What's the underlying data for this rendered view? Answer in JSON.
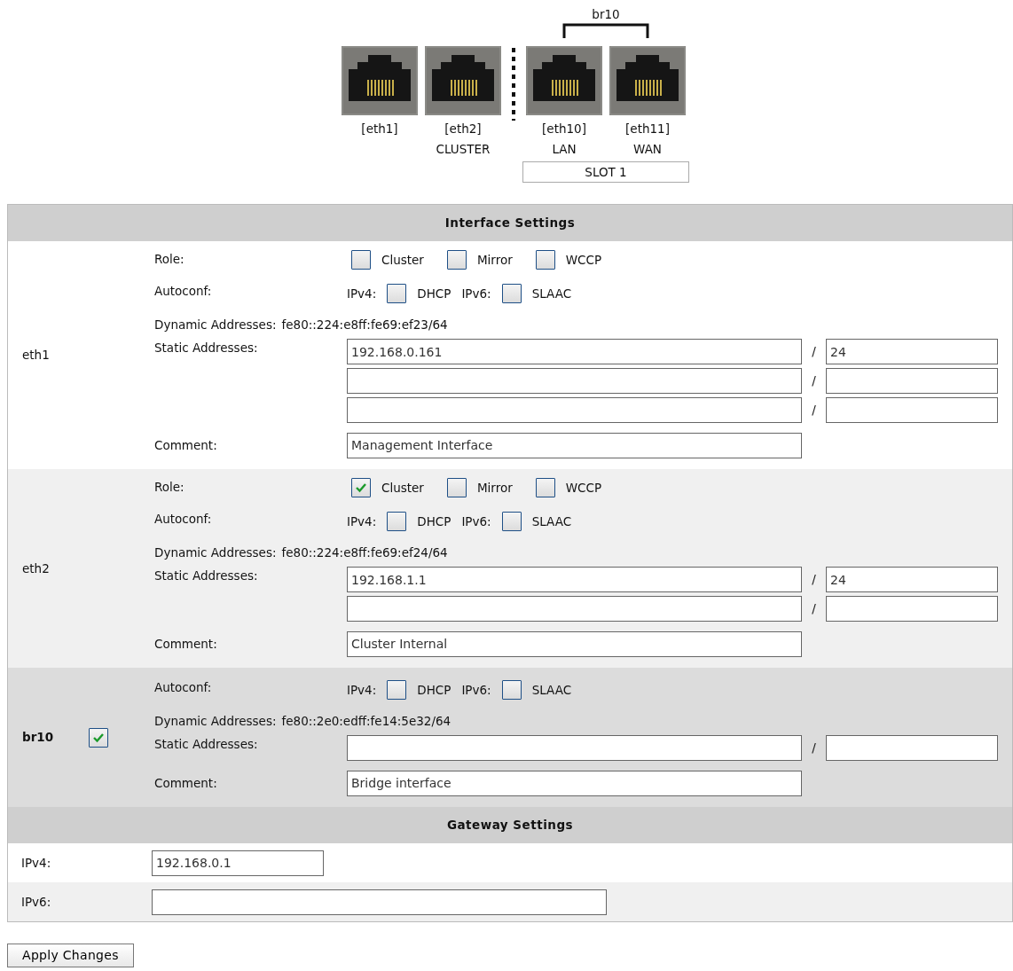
{
  "onboard_ports": [
    {
      "label": "[eth1]"
    },
    {
      "label": "[eth2]",
      "sublabel": "CLUSTER"
    }
  ],
  "slot": {
    "label": "SLOT 1",
    "bridge_label": "br10",
    "ports": [
      {
        "label": "[eth10]",
        "sublabel": "LAN"
      },
      {
        "label": "[eth11]",
        "sublabel": "WAN"
      }
    ]
  },
  "interface_settings": {
    "title": "Interface Settings",
    "interfaces": [
      {
        "kind": "port",
        "name": "eth1",
        "role_label": "Role:",
        "roles": [
          {
            "label": "Cluster",
            "checked": false
          },
          {
            "label": "Mirror",
            "checked": false
          },
          {
            "label": "WCCP",
            "checked": false
          }
        ],
        "autoconf_label": "Autoconf:",
        "ipv4_label": "IPv4:",
        "dhcp": {
          "label": "DHCP",
          "checked": false
        },
        "ipv6_label": "IPv6:",
        "slaac": {
          "label": "SLAAC",
          "checked": false
        },
        "dynamic_label": "Dynamic Addresses:",
        "dynamic_value": "fe80::224:e8ff:fe69:ef23/64",
        "static_label": "Static Addresses:",
        "static_addresses": [
          {
            "address": "192.168.0.161",
            "separator": "/",
            "prefix": "24"
          },
          {
            "separator": "/"
          },
          {
            "separator": "/"
          }
        ],
        "comment_label": "Comment:",
        "comment": "Management Interface"
      },
      {
        "kind": "port",
        "name": "eth2",
        "role_label": "Role:",
        "roles": [
          {
            "label": "Cluster",
            "checked": true
          },
          {
            "label": "Mirror",
            "checked": false
          },
          {
            "label": "WCCP",
            "checked": false
          }
        ],
        "autoconf_label": "Autoconf:",
        "ipv4_label": "IPv4:",
        "dhcp": {
          "label": "DHCP",
          "checked": false
        },
        "ipv6_label": "IPv6:",
        "slaac": {
          "label": "SLAAC",
          "checked": false
        },
        "dynamic_label": "Dynamic Addresses:",
        "dynamic_value": "fe80::224:e8ff:fe69:ef24/64",
        "static_label": "Static Addresses:",
        "static_addresses": [
          {
            "address": "192.168.1.1",
            "separator": "/",
            "prefix": "24"
          },
          {
            "separator": "/"
          }
        ],
        "comment_label": "Comment:",
        "comment": "Cluster Internal"
      },
      {
        "kind": "bridge",
        "name": "br10",
        "enabled": true,
        "autoconf_label": "Autoconf:",
        "ipv4_label": "IPv4:",
        "dhcp": {
          "label": "DHCP",
          "checked": false
        },
        "ipv6_label": "IPv6:",
        "slaac": {
          "label": "SLAAC",
          "checked": false
        },
        "dynamic_label": "Dynamic Addresses:",
        "dynamic_value": "fe80::2e0:edff:fe14:5e32/64",
        "static_label": "Static Addresses:",
        "static_addresses": [
          {
            "separator": "/"
          }
        ],
        "comment_label": "Comment:",
        "comment": "Bridge interface"
      }
    ]
  },
  "gateway_settings": {
    "title": "Gateway Settings",
    "rows": [
      {
        "label": "IPv4:",
        "value": "192.168.0.1"
      },
      {
        "label": "IPv6:"
      }
    ]
  },
  "apply_button": "Apply Changes"
}
